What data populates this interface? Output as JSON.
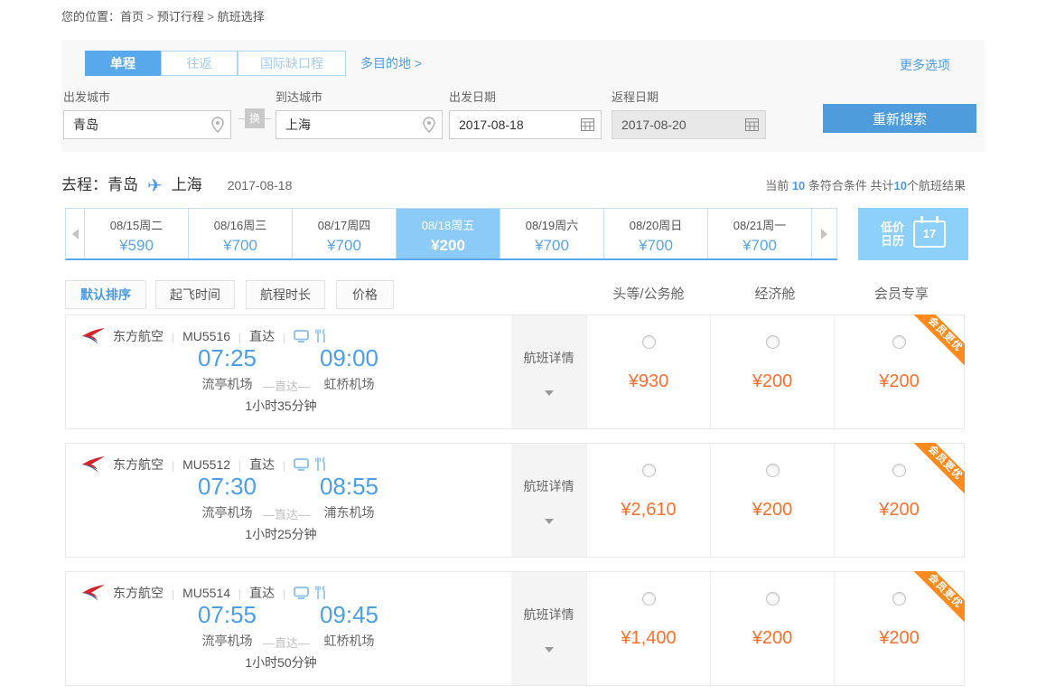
{
  "breadcrumb": {
    "prefix": "您的位置：",
    "items": [
      "首页",
      "预订行程",
      "航班选择"
    ]
  },
  "search": {
    "tabs": [
      {
        "label": "单程",
        "active": true
      },
      {
        "label": "往返",
        "active": false
      },
      {
        "label": "国际缺口程",
        "active": false
      }
    ],
    "multi_city": "多目的地 >",
    "more_options": "更多选项",
    "from": {
      "label": "出发城市",
      "value": "青岛"
    },
    "swap": "换",
    "to": {
      "label": "到达城市",
      "value": "上海"
    },
    "depart": {
      "label": "出发日期",
      "value": "2017-08-18"
    },
    "return": {
      "label": "返程日期",
      "value": "2017-08-20",
      "disabled": true
    },
    "search_btn": "重新搜索"
  },
  "route": {
    "label": "去程：",
    "from": "青岛",
    "to": "上海",
    "date": "2017-08-18",
    "plane_glyph": "✈",
    "summary_parts": [
      {
        "text": "当前 ",
        "highlight": false
      },
      {
        "text": "10",
        "highlight": true
      },
      {
        "text": " 条符合条件 共计",
        "highlight": false
      },
      {
        "text": "10",
        "highlight": true
      },
      {
        "text": "个航班结果",
        "highlight": false
      }
    ]
  },
  "calendar_strip": {
    "days": [
      {
        "date": "08/15周二",
        "price": "¥590",
        "selected": false
      },
      {
        "date": "08/16周三",
        "price": "¥700",
        "selected": false
      },
      {
        "date": "08/17周四",
        "price": "¥700",
        "selected": false
      },
      {
        "date": "08/18周五",
        "price": "¥200",
        "selected": true
      },
      {
        "date": "08/19周六",
        "price": "¥700",
        "selected": false
      },
      {
        "date": "08/20周日",
        "price": "¥700",
        "selected": false
      },
      {
        "date": "08/21周一",
        "price": "¥700",
        "selected": false
      }
    ],
    "low_price": {
      "line1": "低价",
      "line2": "日历",
      "day": "17"
    }
  },
  "sort": {
    "buttons": [
      {
        "label": "默认排序",
        "active": true
      },
      {
        "label": "起飞时间",
        "active": false
      },
      {
        "label": "航程时长",
        "active": false
      },
      {
        "label": "价格",
        "active": false
      }
    ],
    "columns": [
      "头等/公务舱",
      "经济舱",
      "会员专享"
    ]
  },
  "flights": [
    {
      "airline": "东方航空",
      "flight_no": "MU5516",
      "route_type": "直达",
      "dep_time": "07:25",
      "dep_airport": "流亭机场",
      "via": "—直达—",
      "arr_time": "09:00",
      "arr_airport": "虹桥机场",
      "duration": "1小时35分钟",
      "detail": "航班详情",
      "ribbon": "会员更优",
      "prices": [
        "¥930",
        "¥200",
        "¥200"
      ]
    },
    {
      "airline": "东方航空",
      "flight_no": "MU5512",
      "route_type": "直达",
      "dep_time": "07:30",
      "dep_airport": "流亭机场",
      "via": "—直达—",
      "arr_time": "08:55",
      "arr_airport": "浦东机场",
      "duration": "1小时25分钟",
      "detail": "航班详情",
      "ribbon": "会员更优",
      "prices": [
        "¥2,610",
        "¥200",
        "¥200"
      ]
    },
    {
      "airline": "东方航空",
      "flight_no": "MU5514",
      "route_type": "直达",
      "dep_time": "07:55",
      "dep_airport": "流亭机场",
      "via": "—直达—",
      "arr_time": "09:45",
      "arr_airport": "虹桥机场",
      "duration": "1小时50分钟",
      "detail": "航班详情",
      "ribbon": "会员更优",
      "prices": [
        "¥1,400",
        "¥200",
        "¥200"
      ]
    }
  ],
  "colors": {
    "accent_blue": "#4a9ce8",
    "tab_active_blue": "#57a9ec",
    "selected_day_blue": "#8ccbf7",
    "low_price_blue": "#8dd0fa",
    "price_orange": "#ff6f2b",
    "ribbon_orange": "#ff8a1e"
  }
}
